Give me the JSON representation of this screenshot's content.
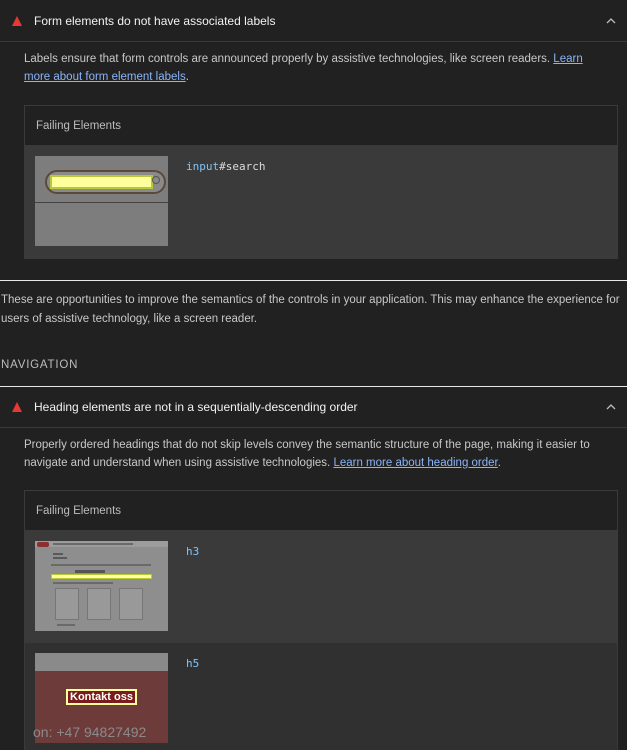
{
  "audit1": {
    "title": "Form elements do not have associated labels",
    "description": "Labels ensure that form controls are announced properly by assistive technologies, like screen readers. ",
    "link": "Learn more about form element labels",
    "failing_header": "Failing Elements",
    "node_tag": "input",
    "node_rest": "#search"
  },
  "group_description": "These are opportunities to improve the semantics of the controls in your application. This may enhance the experience for users of assistive technology, like a screen reader.",
  "group_title": "NAVIGATION",
  "audit2": {
    "title": "Heading elements are not in a sequentially-descending order",
    "description": "Properly ordered headings that do not skip levels convey the semantic structure of the page, making it easier to navigate and understand when using assistive technologies. ",
    "link": "Learn more about heading order",
    "failing_header": "Failing Elements",
    "node1": "h3",
    "node2": "h5",
    "thumb_button": "Kontakt oss",
    "thumb_phone": "on: +47 94827492"
  },
  "colors": {
    "fail": "#e53935",
    "link": "#8ab4f8",
    "node": "#7cc6ff"
  }
}
